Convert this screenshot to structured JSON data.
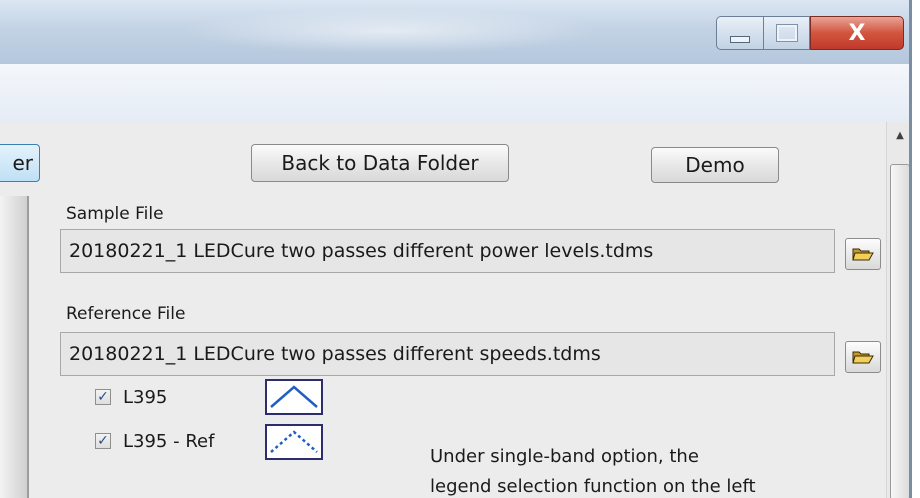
{
  "window": {
    "controls": {
      "minimize_icon": "minimize-icon",
      "maximize_icon": "maximize-icon",
      "close_label": "X"
    }
  },
  "toolbar": {
    "left_button_label": "er",
    "back_button_label": "Back to Data Folder",
    "demo_button_label": "Demo"
  },
  "files": {
    "sample": {
      "label": "Sample File",
      "value": "20180221_1 LEDCure two passes different power levels.tdms"
    },
    "reference": {
      "label": "Reference File",
      "value": "20180221_1 LEDCure two passes different speeds.tdms"
    }
  },
  "legend": {
    "items": [
      {
        "label": "L395",
        "checked": true,
        "line_style": "solid",
        "color": "#1f5fc4"
      },
      {
        "label": "L395  - Ref",
        "checked": true,
        "line_style": "dotted",
        "color": "#1f5fc4"
      }
    ]
  },
  "note": {
    "line1": "Under single-band option, the",
    "line2": "legend selection function on the left"
  },
  "colors": {
    "close_button": "#c0392b",
    "titlebar": "#c3d3e5",
    "panel": "#ececec",
    "legend_line": "#1f5fc4"
  }
}
